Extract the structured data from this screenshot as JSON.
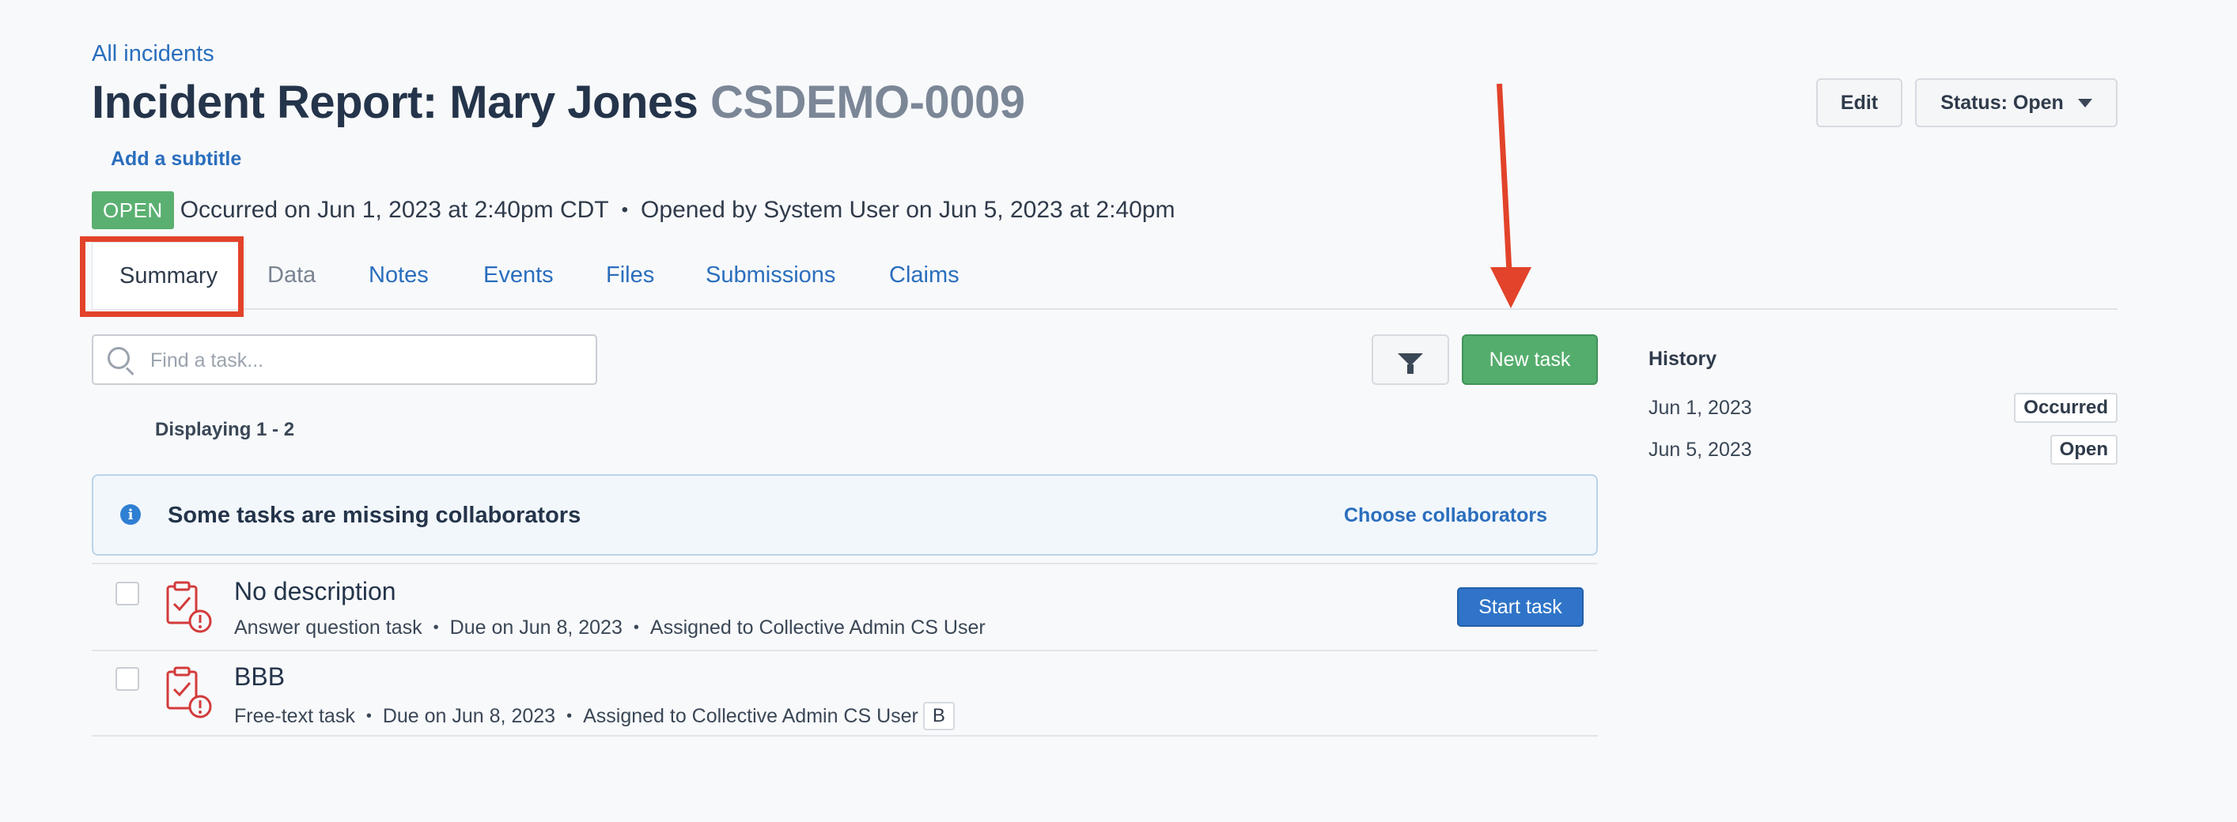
{
  "header": {
    "back_link": "All incidents",
    "title": "Incident Report: Mary Jones",
    "code": "CSDEMO-0009",
    "subtitle_link": "Add a subtitle",
    "edit_label": "Edit",
    "status_label": "Status: Open"
  },
  "meta": {
    "badge": "OPEN",
    "occurred": "Occurred on Jun 1, 2023 at 2:40pm CDT",
    "separator": "•",
    "opened": "Opened by System User on Jun 5, 2023 at 2:40pm"
  },
  "tabs": [
    {
      "label": "Summary",
      "state": "active"
    },
    {
      "label": "Data",
      "state": "disabled"
    },
    {
      "label": "Notes",
      "state": "link"
    },
    {
      "label": "Events",
      "state": "link"
    },
    {
      "label": "Files",
      "state": "link"
    },
    {
      "label": "Submissions",
      "state": "link"
    },
    {
      "label": "Claims",
      "state": "link"
    }
  ],
  "toolbar": {
    "search_placeholder": "Find a task...",
    "new_task_label": "New task"
  },
  "list": {
    "displaying": "Displaying 1 - 2"
  },
  "banner": {
    "text": "Some tasks are missing collaborators",
    "link": "Choose collaborators"
  },
  "tasks": [
    {
      "title": "No description",
      "type": "Answer question task",
      "due": "Due on Jun 8, 2023",
      "assigned": "Assigned to Collective Admin CS User",
      "action": "Start task"
    },
    {
      "title": "BBB",
      "type": "Free-text task",
      "due": "Due on Jun 8, 2023",
      "assigned": "Assigned to Collective Admin CS User",
      "badge": "B"
    }
  ],
  "history": {
    "title": "History",
    "rows": [
      {
        "date": "Jun 1, 2023",
        "label": "Occurred"
      },
      {
        "date": "Jun 5, 2023",
        "label": "Open"
      }
    ]
  },
  "annotations": {
    "highlight_color": "#e2432a",
    "icons": [
      "search-icon",
      "filter-icon",
      "info-icon",
      "task-alert-icon",
      "caret-down-icon",
      "annotation-arrow"
    ]
  },
  "colors": {
    "link": "#2a6ebd",
    "success": "#54ad6c",
    "primary": "#2f74c8",
    "danger": "#d33b3b"
  }
}
